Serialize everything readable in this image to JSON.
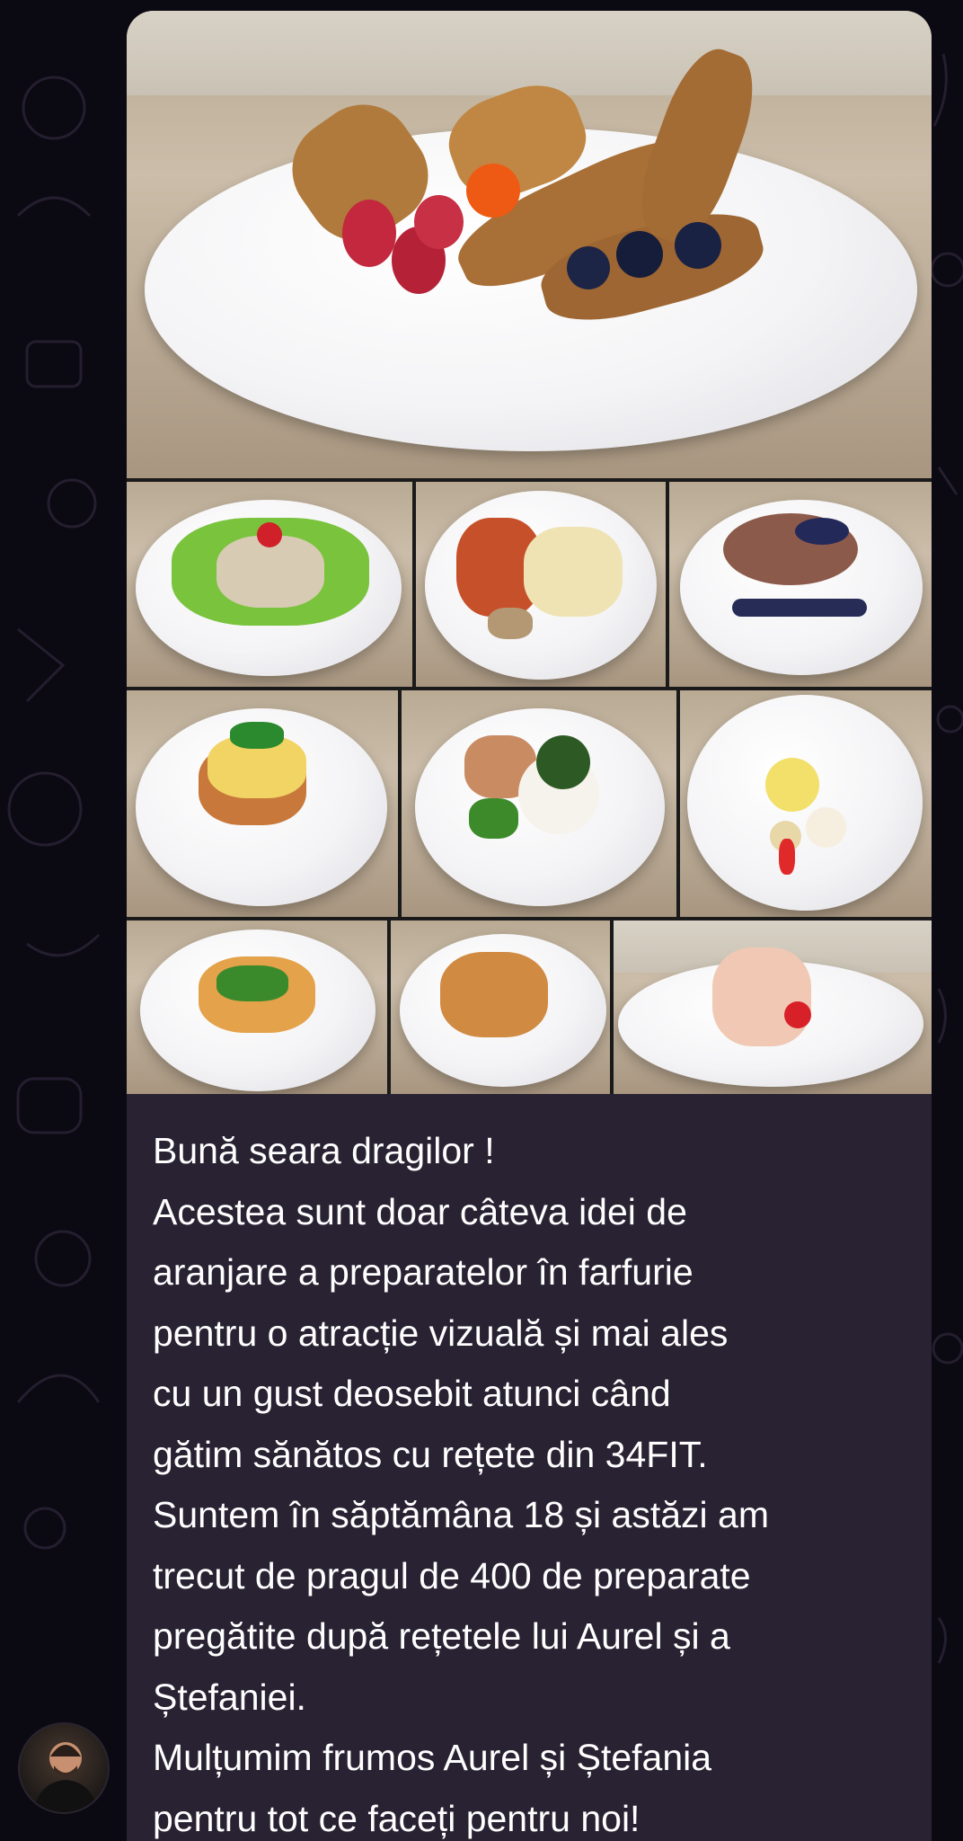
{
  "chat": {
    "message": {
      "lines": [
        "Bună seara dragilor !",
        "Acestea sunt doar câteva idei de",
        "aranjare a preparatelor în farfurie",
        "pentru o atracție vizuală și mai ales",
        "cu un gust deosebit atunci când",
        "gătim sănătos cu rețete din 34FIT.",
        "Suntem în săptămâna 18 și astăzi am",
        "trecut de pragul de 400 de preparate",
        "pregătite după rețetele lui Aurel și a",
        "Ștefaniei.",
        "Mulțumim frumos Aurel și Ștefania",
        "pentru tot ce faceți pentru noi!"
      ]
    },
    "photos": [
      {
        "name": "french-toast-photo"
      },
      {
        "name": "chicken-salad-photo"
      },
      {
        "name": "pasta-vegetables-photo"
      },
      {
        "name": "oatmeal-berries-photo"
      },
      {
        "name": "puree-schnitzel-photo"
      },
      {
        "name": "chicken-rice-photo"
      },
      {
        "name": "fruit-dessert-photo"
      },
      {
        "name": "pasta-salad-photo"
      },
      {
        "name": "chicken-strips-photo"
      },
      {
        "name": "ham-rolls-photo"
      }
    ]
  }
}
